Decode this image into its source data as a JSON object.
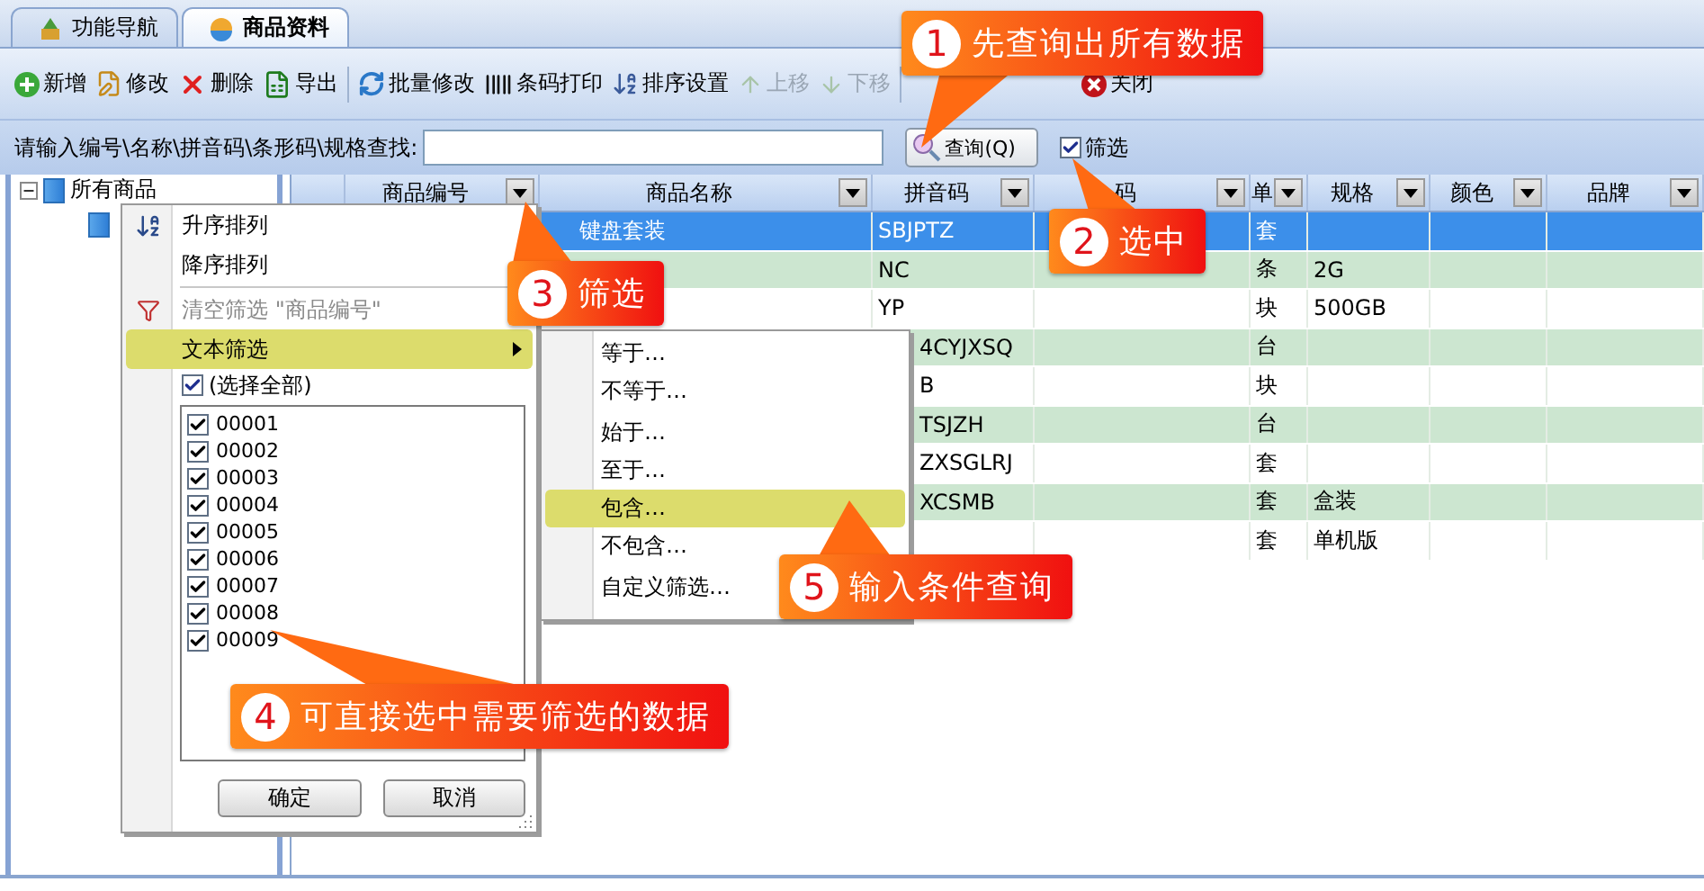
{
  "tabs": [
    {
      "label": "功能导航",
      "selected": false
    },
    {
      "label": "商品资料",
      "selected": true
    }
  ],
  "toolbar": [
    {
      "kind": "add",
      "label": "新增",
      "disabled": false
    },
    {
      "kind": "edit",
      "label": "修改",
      "disabled": false
    },
    {
      "kind": "delete",
      "label": "删除",
      "disabled": false
    },
    {
      "kind": "export",
      "label": "导出",
      "disabled": false
    },
    {
      "kind": "divider"
    },
    {
      "kind": "batch",
      "label": "批量修改",
      "disabled": false
    },
    {
      "kind": "barcode",
      "label": "条码打印",
      "disabled": false
    },
    {
      "kind": "sort",
      "label": "排序设置",
      "disabled": false
    },
    {
      "kind": "up",
      "label": "上移",
      "disabled": true
    },
    {
      "kind": "down",
      "label": "下移",
      "disabled": true
    },
    {
      "kind": "divider"
    },
    {
      "kind": "close",
      "label": "关闭",
      "disabled": false
    }
  ],
  "search": {
    "label": "请输入编号\\名称\\拼音码\\条形码\\规格查找:",
    "button": "查询(Q)",
    "filter_checkbox": {
      "label": "筛选",
      "checked": true
    }
  },
  "tree": {
    "items": [
      {
        "label": "所有商品",
        "expanded": true,
        "children": [
          {
            "kind": "folder"
          }
        ]
      }
    ]
  },
  "table": {
    "columns": [
      "商品编号",
      "商品名称",
      "拼音码",
      "码",
      "单",
      "规格",
      "颜色",
      "品牌"
    ],
    "rows": [
      {
        "selected": true,
        "name": "键盘套装",
        "pinyin": "SBJPTZ",
        "unit": "套"
      },
      {
        "selected": false,
        "pinyin": "NC",
        "unit": "条",
        "spec": "2G"
      },
      {
        "selected": false,
        "pinyin": "YP",
        "unit": "块",
        "spec": "500GB"
      },
      {
        "selected": false,
        "pinyin": "4CYJXSQ",
        "unit": "台"
      },
      {
        "selected": false,
        "pinyin": "B",
        "unit": "块"
      },
      {
        "selected": false,
        "pinyin": "TSJZH",
        "unit": "台"
      },
      {
        "selected": false,
        "pinyin": "ZXSGLRJ",
        "unit": "套"
      },
      {
        "selected": false,
        "pinyin": "XCSMB",
        "unit": "套",
        "spec": "盒装"
      },
      {
        "selected": false,
        "unit": "套",
        "spec": "单机版"
      }
    ]
  },
  "filter_menu": {
    "items": [
      {
        "kind": "sort_asc",
        "label": "升序排列",
        "disabled": false,
        "highlighted": false
      },
      {
        "kind": "sort_desc",
        "label": "降序排列",
        "disabled": false,
        "highlighted": false
      },
      {
        "kind": "clear",
        "label": "清空筛选 \"商品编号\"",
        "disabled": true,
        "highlighted": false
      },
      {
        "kind": "submenu",
        "label": "文本筛选",
        "disabled": false,
        "highlighted": true
      }
    ],
    "select_all": {
      "label": "(选择全部)",
      "checked": true
    },
    "values": [
      {
        "label": "00001",
        "checked": true
      },
      {
        "label": "00002",
        "checked": true
      },
      {
        "label": "00003",
        "checked": true
      },
      {
        "label": "00004",
        "checked": true
      },
      {
        "label": "00005",
        "checked": true
      },
      {
        "label": "00006",
        "checked": true
      },
      {
        "label": "00007",
        "checked": true
      },
      {
        "label": "00008",
        "checked": true
      },
      {
        "label": "00009",
        "checked": true
      }
    ],
    "buttons": [
      "确定",
      "取消"
    ]
  },
  "submenu": {
    "items": [
      {
        "label": "等于…",
        "highlighted": false,
        "separator_after": false
      },
      {
        "label": "不等于…",
        "highlighted": false,
        "separator_after": true
      },
      {
        "label": "始于…",
        "highlighted": false,
        "separator_after": false
      },
      {
        "label": "至于…",
        "highlighted": false,
        "separator_after": false
      },
      {
        "label": "包含…",
        "highlighted": true,
        "separator_after": false
      },
      {
        "label": "不包含…",
        "highlighted": false,
        "separator_after": true
      },
      {
        "label": "自定义筛选…",
        "highlighted": false,
        "separator_after": false
      }
    ]
  },
  "callouts": [
    {
      "number": "1",
      "text": "先查询出所有数据"
    },
    {
      "number": "2",
      "text": "选中"
    },
    {
      "number": "3",
      "text": "筛选"
    },
    {
      "number": "4",
      "text": "可直接选中需要筛选的数据"
    },
    {
      "number": "5",
      "text": "输入条件查询"
    }
  ]
}
